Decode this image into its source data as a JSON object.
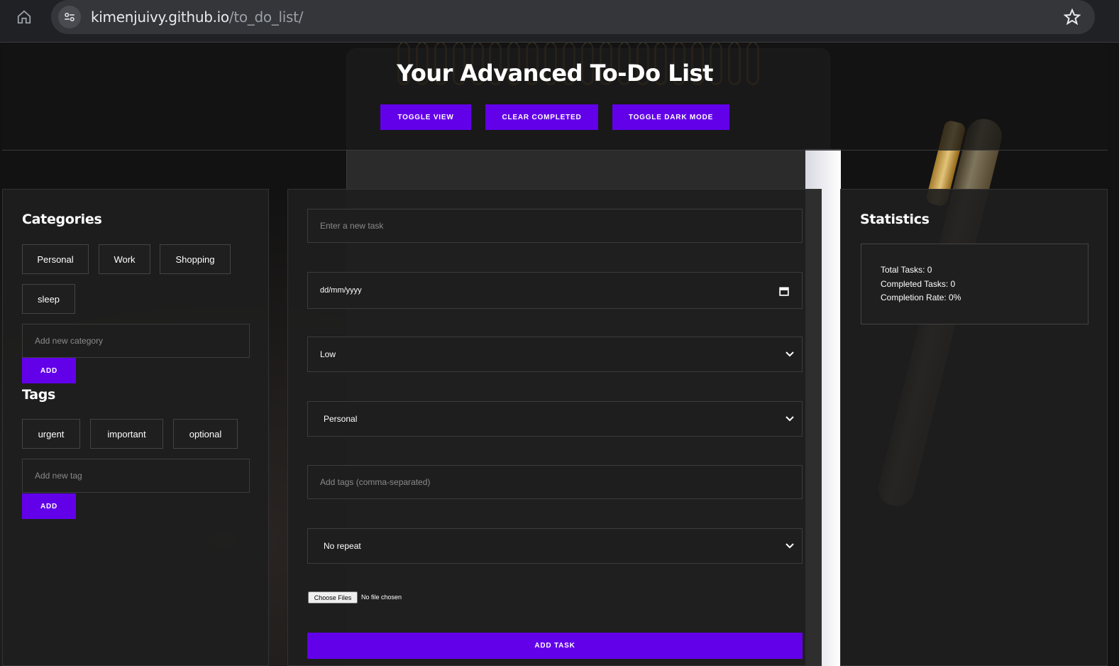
{
  "browser": {
    "url_host": "kimenjuivy.github.io",
    "url_path": "/to_do_list/"
  },
  "header": {
    "title": "Your Advanced To-Do List",
    "buttons": {
      "toggle_view": "TOGGLE VIEW",
      "clear_completed": "CLEAR COMPLETED",
      "toggle_dark_mode": "TOGGLE DARK MODE"
    }
  },
  "categories": {
    "heading": "Categories",
    "items": [
      "Personal",
      "Work",
      "Shopping",
      "sleep"
    ],
    "input_placeholder": "Add new category",
    "add_label": "ADD"
  },
  "tags": {
    "heading": "Tags",
    "items": [
      "urgent",
      "important",
      "optional"
    ],
    "input_placeholder": "Add new tag",
    "add_label": "ADD"
  },
  "task_form": {
    "task_placeholder": "Enter a new task",
    "date_placeholder": "dd/mm/yyyy",
    "priority_value": "Low",
    "category_value": "Personal",
    "tags_placeholder": "Add tags (comma-separated)",
    "repeat_value": "No repeat",
    "file_button": "Choose Files",
    "file_status": "No file chosen",
    "submit_label": "ADD TASK"
  },
  "statistics": {
    "heading": "Statistics",
    "total": "Total Tasks: 0",
    "completed": "Completed Tasks: 0",
    "rate": "Completion Rate: 0%"
  },
  "colors": {
    "accent": "#6200ea",
    "panel": "#1e1e1e",
    "background": "#151515"
  }
}
